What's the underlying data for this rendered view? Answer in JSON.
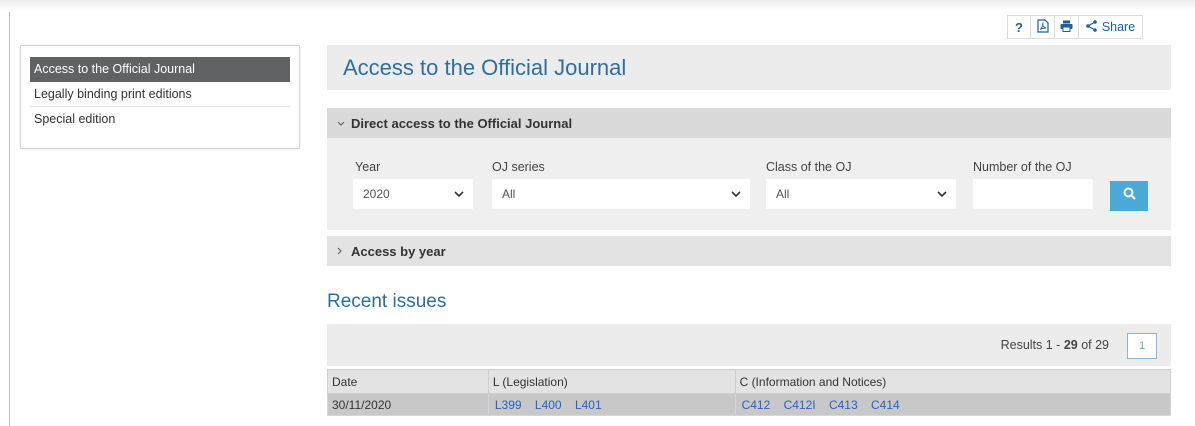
{
  "toolbar": {
    "help_label": "?",
    "share_label": "Share"
  },
  "sidebar": {
    "items": [
      {
        "label": "Access to the Official Journal",
        "active": true
      },
      {
        "label": "Legally binding print editions",
        "active": false
      },
      {
        "label": "Special edition",
        "active": false
      }
    ]
  },
  "page": {
    "title": "Access to the Official Journal"
  },
  "direct_access": {
    "heading": "Direct access to the Official Journal",
    "year_label": "Year",
    "year_value": "2020",
    "series_label": "OJ series",
    "series_value": "All",
    "class_label": "Class of the OJ",
    "class_value": "All",
    "number_label": "Number of the OJ",
    "number_value": ""
  },
  "access_by_year": {
    "heading": "Access by year"
  },
  "recent": {
    "heading": "Recent issues",
    "results_prefix": "Results 1 - ",
    "results_shown": "29",
    "results_of": " of 29",
    "page": "1",
    "columns": [
      "Date",
      "L (Legislation)",
      "C (Information and Notices)"
    ],
    "rows": [
      {
        "date": "30/11/2020",
        "l": [
          "L399",
          "L400",
          "L401"
        ],
        "c": [
          "C412",
          "C412I",
          "C413",
          "C414"
        ]
      }
    ]
  },
  "colors": {
    "accent": "#2e6f9e",
    "button": "#4aa9d6",
    "link": "#2862c4"
  }
}
